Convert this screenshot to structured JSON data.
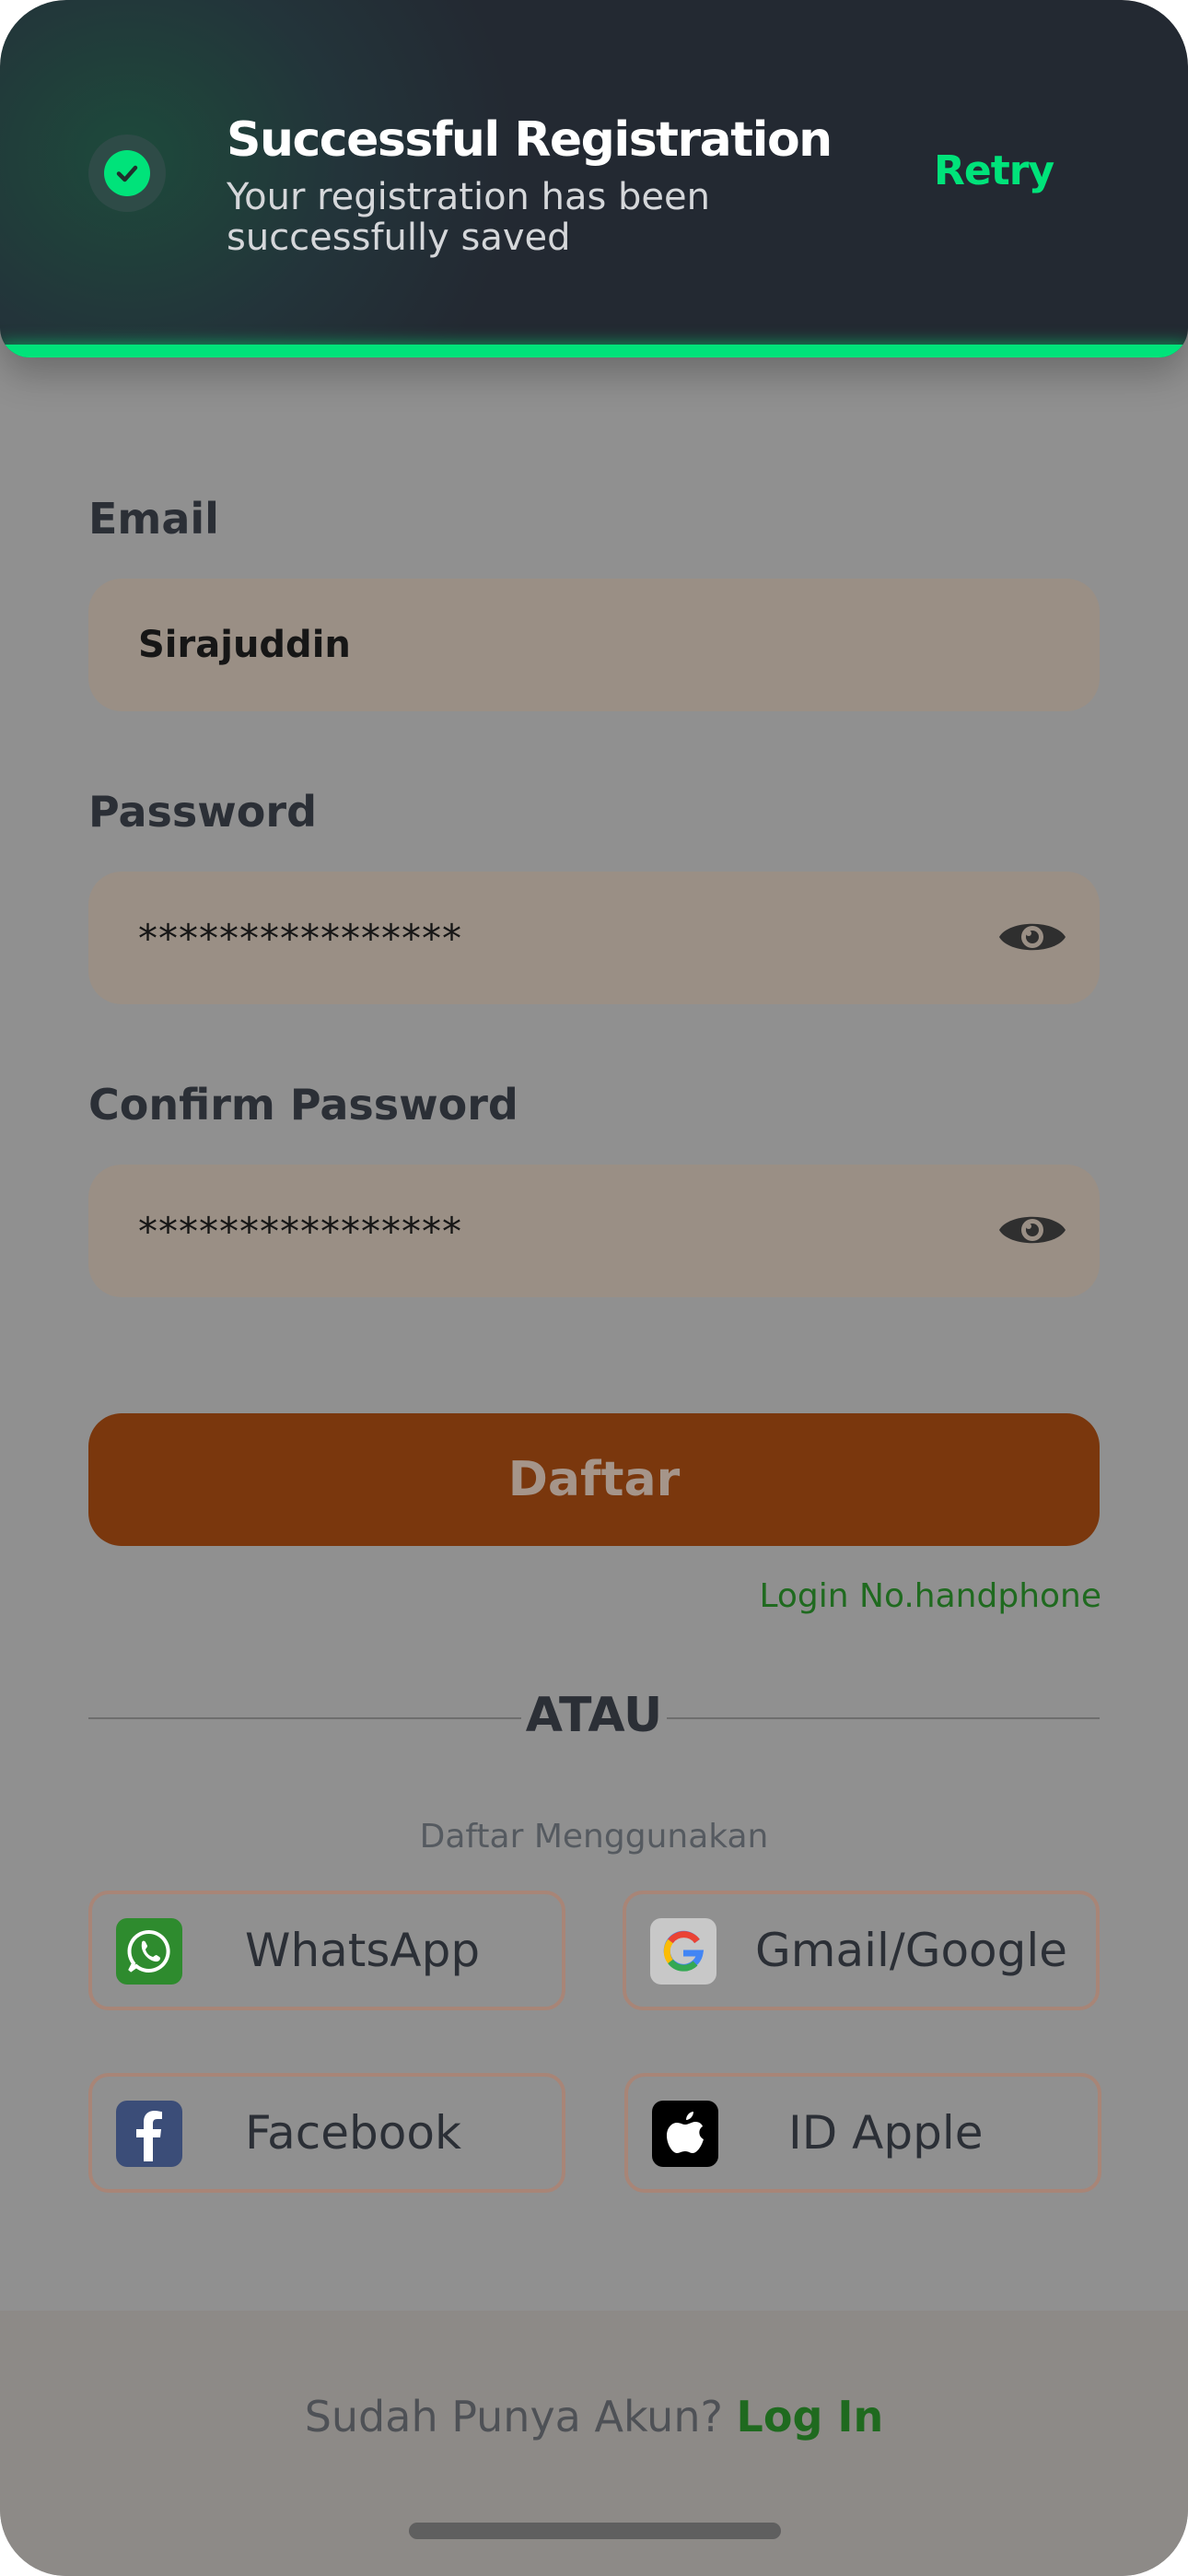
{
  "toast": {
    "title": "Successful Registration",
    "message": "Your registration has been successfully saved",
    "action_label": "Retry",
    "icon": "check-circle-icon",
    "accent_color": "#00e37a"
  },
  "form": {
    "email": {
      "label": "Email",
      "value": "Sirajuddin"
    },
    "password": {
      "label": "Password",
      "value": "****************",
      "toggle_icon": "eye-icon"
    },
    "confirm_password": {
      "label": "Confirm Password",
      "value": "****************",
      "toggle_icon": "eye-icon"
    },
    "submit_label": "Daftar",
    "alt_login_label": "Login No.handphone"
  },
  "divider": {
    "label": "ATAU"
  },
  "social": {
    "heading": "Daftar Menggunakan",
    "buttons": [
      {
        "label": "WhatsApp",
        "icon": "whatsapp-icon",
        "color": "#2e8b2e"
      },
      {
        "label": "Gmail/Google",
        "icon": "google-icon",
        "color": "#c8c8c8"
      },
      {
        "label": "Facebook",
        "icon": "facebook-icon",
        "color": "#3b4d78"
      },
      {
        "label": "ID Apple",
        "icon": "apple-icon",
        "color": "#000000"
      }
    ]
  },
  "footer": {
    "prompt": "Sudah Punya Akun?",
    "link_label": "Log In"
  },
  "colors": {
    "primary_button": "#7a370d",
    "link_green": "#1f6a1f",
    "overlay": "#909090"
  }
}
